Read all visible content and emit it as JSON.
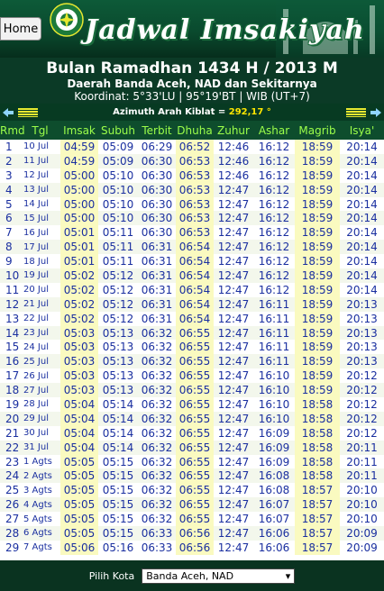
{
  "header": {
    "home_label": "Home",
    "brand": "Jadwal Imsakiyah",
    "logo_text": "KEMENTERIAN AGAMA",
    "title": "Bulan Ramadhan 1434 H / 2013 M",
    "area": "Daerah Banda Aceh, NAD dan Sekitarnya",
    "coordinates": "Koordinat: 5°33'LU | 95°19'BT | WIB (UT+7)"
  },
  "kiblat": {
    "label": "Azimuth Arah Kiblat =",
    "value": "292,17 °"
  },
  "table": {
    "columns": [
      "Rmd",
      "Tgl",
      "Imsak",
      "Subuh",
      "Terbit",
      "Dhuha",
      "Zuhur",
      "Ashar",
      "Magrib",
      "Isya'"
    ],
    "rows": [
      [
        "1",
        "10 Jul",
        "04:59",
        "05:09",
        "06:29",
        "06:52",
        "12:46",
        "16:12",
        "18:59",
        "20:14"
      ],
      [
        "2",
        "11 Jul",
        "04:59",
        "05:09",
        "06:30",
        "06:53",
        "12:46",
        "16:12",
        "18:59",
        "20:14"
      ],
      [
        "3",
        "12 Jul",
        "05:00",
        "05:10",
        "06:30",
        "06:53",
        "12:46",
        "16:12",
        "18:59",
        "20:14"
      ],
      [
        "4",
        "13 Jul",
        "05:00",
        "05:10",
        "06:30",
        "06:53",
        "12:47",
        "16:12",
        "18:59",
        "20:14"
      ],
      [
        "5",
        "14 Jul",
        "05:00",
        "05:10",
        "06:30",
        "06:53",
        "12:47",
        "16:12",
        "18:59",
        "20:14"
      ],
      [
        "6",
        "15 Jul",
        "05:00",
        "05:10",
        "06:30",
        "06:53",
        "12:47",
        "16:12",
        "18:59",
        "20:14"
      ],
      [
        "7",
        "16 Jul",
        "05:01",
        "05:11",
        "06:30",
        "06:53",
        "12:47",
        "16:12",
        "18:59",
        "20:14"
      ],
      [
        "8",
        "17 Jul",
        "05:01",
        "05:11",
        "06:31",
        "06:54",
        "12:47",
        "16:12",
        "18:59",
        "20:14"
      ],
      [
        "9",
        "18 Jul",
        "05:01",
        "05:11",
        "06:31",
        "06:54",
        "12:47",
        "16:12",
        "18:59",
        "20:14"
      ],
      [
        "10",
        "19 Jul",
        "05:02",
        "05:12",
        "06:31",
        "06:54",
        "12:47",
        "16:12",
        "18:59",
        "20:14"
      ],
      [
        "11",
        "20 Jul",
        "05:02",
        "05:12",
        "06:31",
        "06:54",
        "12:47",
        "16:12",
        "18:59",
        "20:14"
      ],
      [
        "12",
        "21 Jul",
        "05:02",
        "05:12",
        "06:31",
        "06:54",
        "12:47",
        "16:11",
        "18:59",
        "20:13"
      ],
      [
        "13",
        "22 Jul",
        "05:02",
        "05:12",
        "06:31",
        "06:54",
        "12:47",
        "16:11",
        "18:59",
        "20:13"
      ],
      [
        "14",
        "23 Jul",
        "05:03",
        "05:13",
        "06:32",
        "06:55",
        "12:47",
        "16:11",
        "18:59",
        "20:13"
      ],
      [
        "15",
        "24 Jul",
        "05:03",
        "05:13",
        "06:32",
        "06:55",
        "12:47",
        "16:11",
        "18:59",
        "20:13"
      ],
      [
        "16",
        "25 Jul",
        "05:03",
        "05:13",
        "06:32",
        "06:55",
        "12:47",
        "16:11",
        "18:59",
        "20:13"
      ],
      [
        "17",
        "26 Jul",
        "05:03",
        "05:13",
        "06:32",
        "06:55",
        "12:47",
        "16:10",
        "18:59",
        "20:12"
      ],
      [
        "18",
        "27 Jul",
        "05:03",
        "05:13",
        "06:32",
        "06:55",
        "12:47",
        "16:10",
        "18:59",
        "20:12"
      ],
      [
        "19",
        "28 Jul",
        "05:04",
        "05:14",
        "06:32",
        "06:55",
        "12:47",
        "16:10",
        "18:58",
        "20:12"
      ],
      [
        "20",
        "29 Jul",
        "05:04",
        "05:14",
        "06:32",
        "06:55",
        "12:47",
        "16:10",
        "18:58",
        "20:12"
      ],
      [
        "21",
        "30 Jul",
        "05:04",
        "05:14",
        "06:32",
        "06:55",
        "12:47",
        "16:09",
        "18:58",
        "20:12"
      ],
      [
        "22",
        "31 Jul",
        "05:04",
        "05:14",
        "06:32",
        "06:55",
        "12:47",
        "16:09",
        "18:58",
        "20:11"
      ],
      [
        "23",
        "1 Agts",
        "05:05",
        "05:15",
        "06:32",
        "06:55",
        "12:47",
        "16:09",
        "18:58",
        "20:11"
      ],
      [
        "24",
        "2 Agts",
        "05:05",
        "05:15",
        "06:32",
        "06:55",
        "12:47",
        "16:08",
        "18:58",
        "20:11"
      ],
      [
        "25",
        "3 Agts",
        "05:05",
        "05:15",
        "06:32",
        "06:55",
        "12:47",
        "16:08",
        "18:57",
        "20:10"
      ],
      [
        "26",
        "4 Agts",
        "05:05",
        "05:15",
        "06:32",
        "06:55",
        "12:47",
        "16:07",
        "18:57",
        "20:10"
      ],
      [
        "27",
        "5 Agts",
        "05:05",
        "05:15",
        "06:32",
        "06:55",
        "12:47",
        "16:07",
        "18:57",
        "20:10"
      ],
      [
        "28",
        "6 Agts",
        "05:05",
        "05:15",
        "06:33",
        "06:56",
        "12:47",
        "16:06",
        "18:57",
        "20:09"
      ],
      [
        "29",
        "7 Agts",
        "05:06",
        "05:16",
        "06:33",
        "06:56",
        "12:47",
        "16:06",
        "18:57",
        "20:09"
      ]
    ]
  },
  "footer": {
    "label": "Pilih Kota",
    "selected_city": "Banda Aceh, NAD"
  },
  "colors": {
    "header_green": "#0b3a26",
    "column_header_text": "#9cff4a",
    "highlight_column": "#fafac0",
    "cell_text": "#1a2fa0",
    "kiblat_value": "#ffe600"
  },
  "icons": {
    "prev": "arrow-left-icon",
    "next": "arrow-right-icon",
    "logo": "kemenag-logo-icon"
  }
}
